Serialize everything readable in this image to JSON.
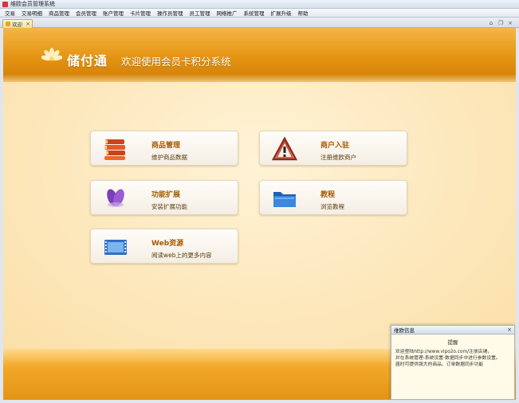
{
  "window": {
    "title": "维欧会员管理系统"
  },
  "menu": [
    "交易",
    "交易明细",
    "商品管理",
    "会员管理",
    "账户管理",
    "卡片管理",
    "操作员管理",
    "员工管理",
    "网络推广",
    "系统管理",
    "扩展升级",
    "帮助"
  ],
  "tabs": [
    {
      "label": "欢迎"
    }
  ],
  "banner": {
    "brand": "储付通",
    "welcome": "欢迎使用会员卡积分系统"
  },
  "cards": [
    {
      "title": "商品管理",
      "subtitle": "维护商品数据",
      "icon": "books-icon"
    },
    {
      "title": "商户入驻",
      "subtitle": "注册维欧商户",
      "icon": "warning-icon"
    },
    {
      "title": "功能扩展",
      "subtitle": "安装扩展功能",
      "icon": "petal-icon"
    },
    {
      "title": "教程",
      "subtitle": "浏览教程",
      "icon": "folder-icon"
    },
    {
      "title": "Web资源",
      "subtitle": "阅读web上的更多内容",
      "icon": "film-icon"
    }
  ],
  "popup": {
    "title": "维欧信息",
    "subtitle": "提醒",
    "lines": [
      "欢迎登陆http://www.vipo2o.com/注册店铺，",
      "并在系统管理-系统设置-数据同步中进行参数设置。",
      "届时可提供强大的商品、订单数据同步功能"
    ]
  },
  "colors": {
    "accent": "#e49412",
    "background": "#fdebc2",
    "title_text": "#a55a00"
  }
}
